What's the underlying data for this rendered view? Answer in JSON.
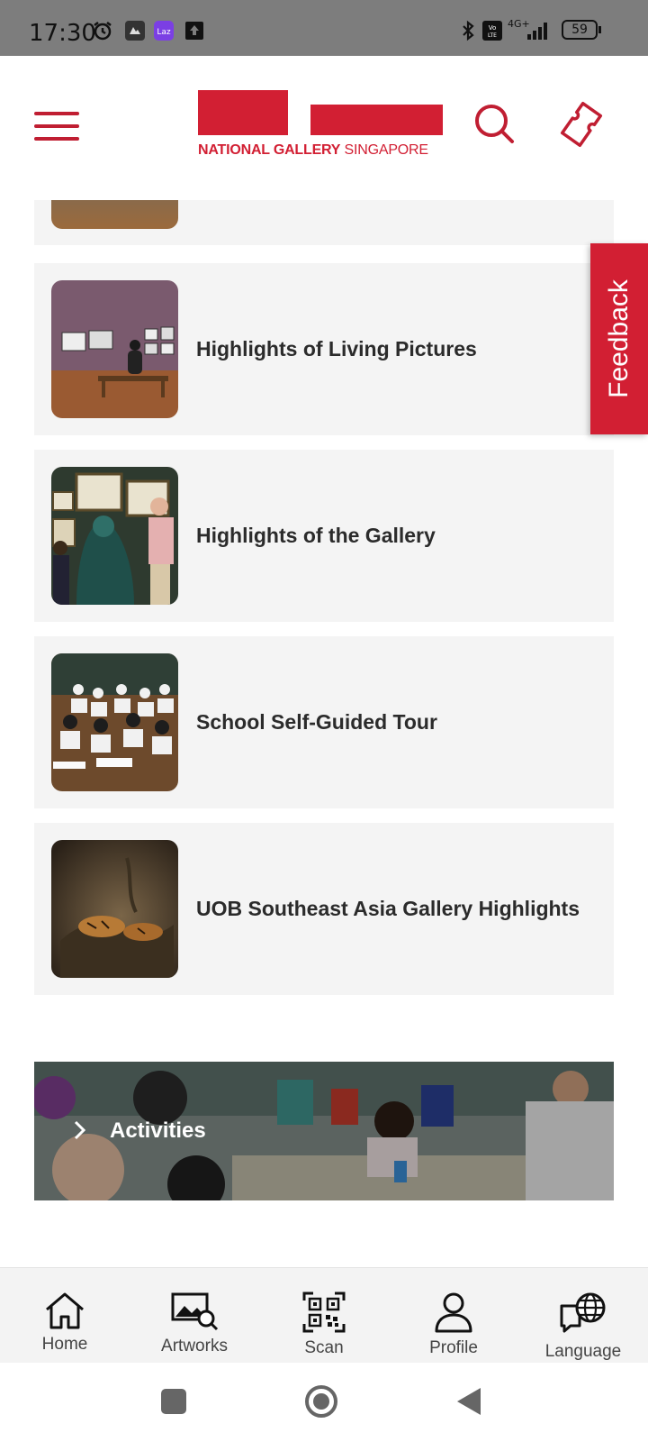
{
  "status_bar": {
    "time": "17:30",
    "battery": "59",
    "network": "4G+",
    "icons": [
      "alarm-icon",
      "app-icon",
      "lazada-icon",
      "upload-icon",
      "bluetooth-icon",
      "volte-icon",
      "signal-icon",
      "battery-icon"
    ]
  },
  "header": {
    "logo_text_bold": "NATIONAL GALLERY",
    "logo_text_regular": "SINGAPORE",
    "brand_color": "#d21f33"
  },
  "feedback": {
    "label": "Feedback"
  },
  "tours": [
    {
      "title": "Highlights of Living Pictures"
    },
    {
      "title": "Highlights of the Gallery"
    },
    {
      "title": "School Self-Guided Tour"
    },
    {
      "title": "UOB Southeast Asia Gallery Highlights"
    }
  ],
  "activities": {
    "label": "Activities"
  },
  "tab_bar": {
    "items": [
      {
        "label": "Home",
        "icon": "home-icon"
      },
      {
        "label": "Artworks",
        "icon": "artworks-icon"
      },
      {
        "label": "Scan",
        "icon": "qr-scan-icon"
      },
      {
        "label": "Profile",
        "icon": "profile-icon"
      },
      {
        "label": "Language",
        "icon": "language-icon"
      }
    ]
  },
  "system_nav": [
    "recents-button",
    "home-button",
    "back-button"
  ]
}
